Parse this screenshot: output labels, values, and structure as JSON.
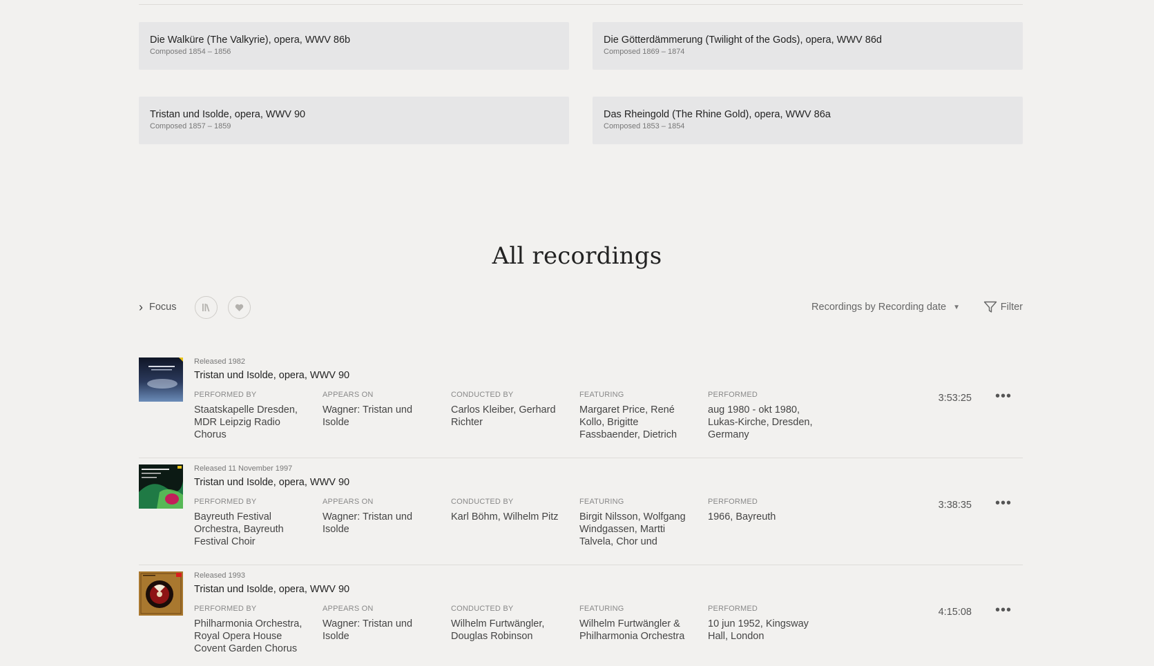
{
  "works": [
    {
      "title": "Die Walküre (The Valkyrie), opera, WWV 86b",
      "composed": "Composed 1854 – 1856"
    },
    {
      "title": "Die Götterdämmerung (Twilight of the Gods), opera, WWV 86d",
      "composed": "Composed 1869 – 1874"
    },
    {
      "title": "Tristan und Isolde, opera, WWV 90",
      "composed": "Composed 1857 – 1859"
    },
    {
      "title": "Das Rheingold (The Rhine Gold), opera, WWV 86a",
      "composed": "Composed 1853 – 1854"
    }
  ],
  "section_title": "All recordings",
  "toolbar": {
    "focus_label": "Focus",
    "sort_label": "Recordings by Recording date",
    "filter_label": "Filter"
  },
  "columns": {
    "performed_by": "PERFORMED BY",
    "appears_on": "APPEARS ON",
    "conducted_by": "CONDUCTED BY",
    "featuring": "FEATURING",
    "performed": "PERFORMED"
  },
  "recordings": [
    {
      "released": "Released 1982",
      "title": "Tristan und Isolde, opera, WWV 90",
      "performed_by": "Staatskapelle Dresden, MDR Leipzig Radio Chorus",
      "appears_on": "Wagner: Tristan und Isolde",
      "conducted_by": "Carlos Kleiber,  Gerhard Richter",
      "featuring": "Margaret Price, René Kollo, Brigitte Fassbaender, Dietrich",
      "performed": "aug 1980 - okt 1980, Lukas-Kirche, Dresden, Germany",
      "duration": "3:53:25"
    },
    {
      "released": "Released 11 November 1997",
      "title": "Tristan und Isolde, opera, WWV 90",
      "performed_by": "Bayreuth Festival Orchestra, Bayreuth Festival Choir",
      "appears_on": "Wagner: Tristan und Isolde",
      "conducted_by": "Karl Böhm,  Wilhelm Pitz",
      "featuring": "Birgit Nilsson, Wolfgang Windgassen, Martti Talvela, Chor und",
      "performed": "1966, Bayreuth",
      "duration": "3:38:35"
    },
    {
      "released": "Released 1993",
      "title": "Tristan und Isolde, opera, WWV 90",
      "performed_by": "Philharmonia Orchestra, Royal Opera House Covent Garden Chorus",
      "appears_on": "Wagner: Tristan und Isolde",
      "conducted_by": "Wilhelm Furtwängler, Douglas Robinson",
      "featuring": "Wilhelm Furtwängler & Philharmonia Orchestra",
      "performed": "10 jun 1952, Kingsway Hall, London",
      "duration": "4:15:08"
    }
  ],
  "icons": {
    "focus": "chevron-right-icon",
    "library": "library-icon",
    "favorite": "heart-icon",
    "sort": "caret-down-icon",
    "filter": "filter-icon",
    "more": "more-horizontal-icon"
  }
}
